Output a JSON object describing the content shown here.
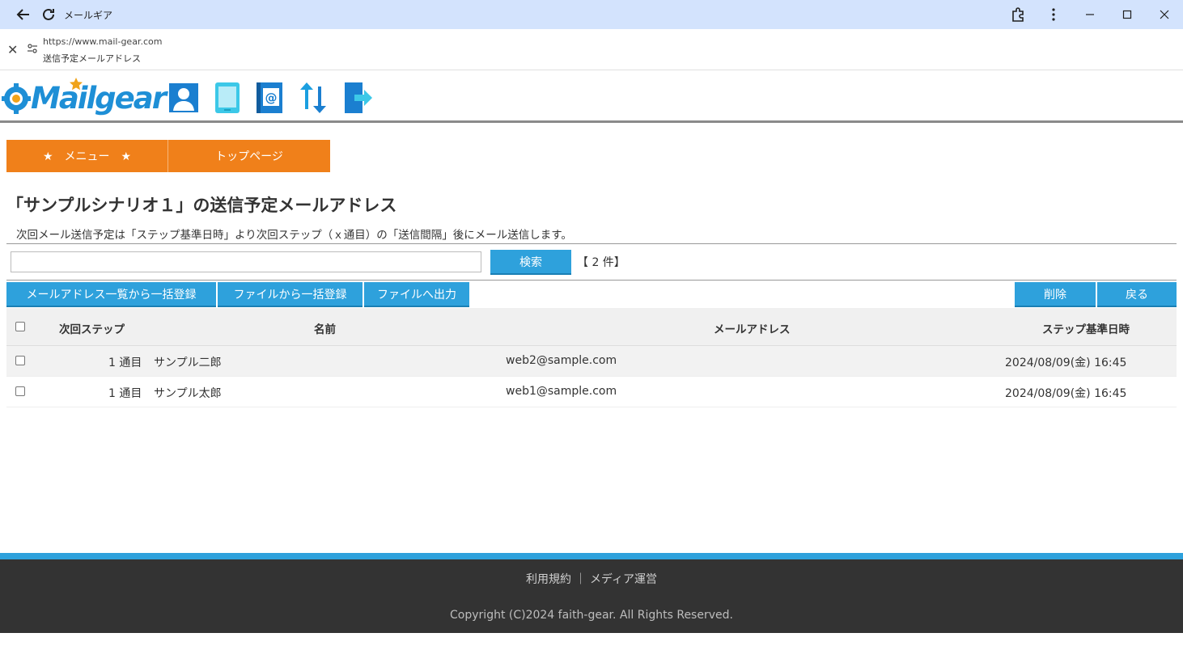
{
  "browser": {
    "window_title": "メールギア",
    "url": "https://www.mail-gear.com",
    "page_title": "送信予定メールアドレス"
  },
  "header": {
    "logo_text": "Mailgear",
    "icons": [
      "user-icon",
      "tablet-icon",
      "address-book-icon",
      "sync-icon",
      "logout-icon"
    ]
  },
  "nav": {
    "menu_label": "★　メニュー　★",
    "top_label": "トップページ"
  },
  "main": {
    "title": "「サンプルシナリオ１」の送信予定メールアドレス",
    "description": "次回メール送信予定は「ステップ基準日時」より次回ステップ（ｘ通目）の「送信間隔」後にメール送信します。",
    "search_placeholder": "",
    "search_label": "検索",
    "count_label": "【 2 件】",
    "buttons": {
      "bulk_from_list": "メールアドレス一覧から一括登録",
      "bulk_from_file": "ファイルから一括登録",
      "export_file": "ファイルへ出力",
      "delete": "削除",
      "back": "戻る"
    }
  },
  "table": {
    "headers": {
      "next_step": "次回ステップ",
      "name": "名前",
      "email": "メールアドレス",
      "base_datetime": "ステップ基準日時"
    },
    "rows": [
      {
        "step": "1 通目",
        "name": "サンプル二郎",
        "email": "web2@sample.com",
        "datetime": "2024/08/09(金) 16:45"
      },
      {
        "step": "1 通目",
        "name": "サンプル太郎",
        "email": "web1@sample.com",
        "datetime": "2024/08/09(金) 16:45"
      }
    ]
  },
  "footer": {
    "terms": "利用規約",
    "separator": "｜",
    "media": "メディア運営",
    "copyright": "Copyright (C)2024 faith-gear. All Rights Reserved."
  },
  "colors": {
    "accent_orange": "#f0801a",
    "accent_blue": "#2ea1dc",
    "footer_bg": "#333333",
    "titlebar_bg": "#d3e3fd"
  }
}
